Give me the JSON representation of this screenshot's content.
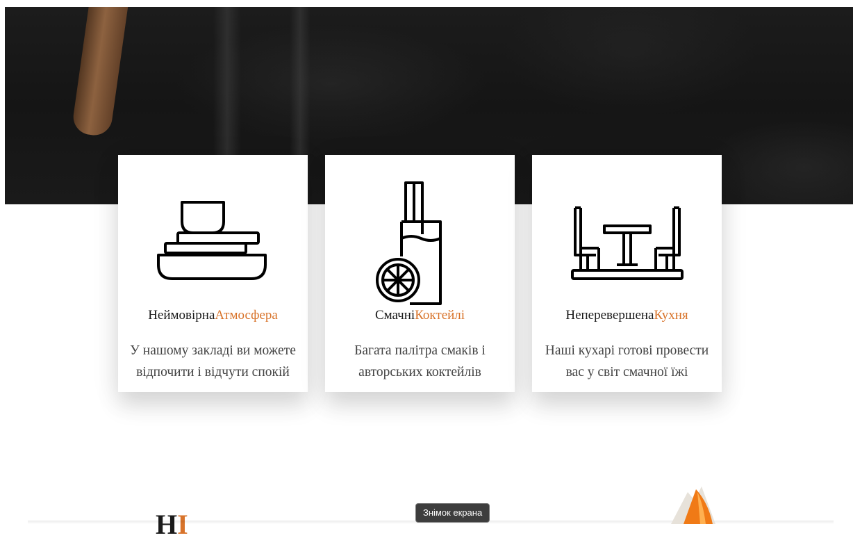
{
  "features": [
    {
      "title_main": "Неймовірна",
      "title_accent": "Атмосфера",
      "description": "У нашому закладі ви можете відпочити і відчути спокій",
      "icon": "dishes-icon"
    },
    {
      "title_main": "Смачні",
      "title_accent": "Коктейлі",
      "description": "Багата палітра смаків і авторських коктейлів",
      "icon": "cocktail-icon"
    },
    {
      "title_main": "Неперевершена",
      "title_accent": "Кухня",
      "description": "Наші кухарі готові провести вас у світ смачної їжі",
      "icon": "table-chairs-icon"
    }
  ],
  "next_section": {
    "heading_main": "Н",
    "heading_accent": "І"
  },
  "tooltip": "Знімок екрана",
  "colors": {
    "accent": "#d8732a",
    "hero_bg": "#1a1a1a"
  }
}
